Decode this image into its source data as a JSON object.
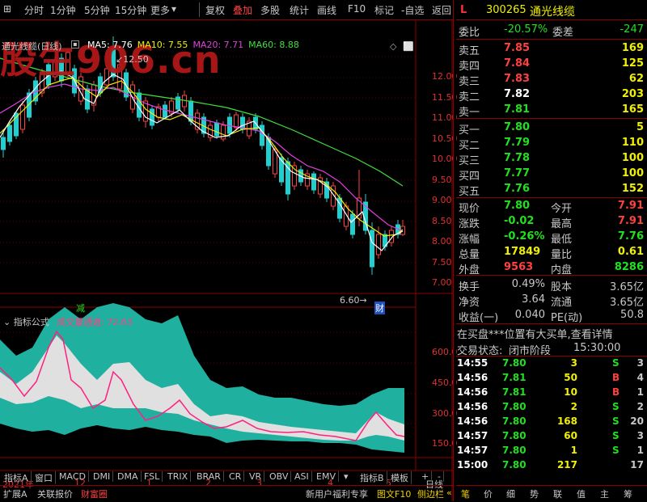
{
  "toolbar": {
    "left": [
      "分时",
      "1分钟",
      "5分钟",
      "15分钟",
      "更多"
    ],
    "right": [
      "复权",
      "叠加",
      "多股",
      "统计",
      "画线",
      "F10",
      "标记",
      "-自选",
      "返回"
    ]
  },
  "watermark": "股生906.cn",
  "main_chart": {
    "title": "通光线缆(日线)",
    "ma": [
      {
        "label": "MA5: 7.76",
        "color": "#ffffff"
      },
      {
        "label": "MA10: 7.55",
        "color": "#f0f000"
      },
      {
        "label": "MA20: 7.71",
        "color": "#e040e0"
      },
      {
        "label": "MA60: 8.88",
        "color": "#40e040"
      }
    ],
    "high_label": "12.50",
    "low_label": "6.60",
    "mark_jian": "减",
    "mark_cai": "财",
    "y_ticks": [
      "12.00",
      "11.50",
      "11.00",
      "10.50",
      "10.00",
      "9.50",
      "9.00",
      "8.50",
      "8.00",
      "7.50",
      "7.00"
    ]
  },
  "indicator": {
    "title": "指标公式",
    "name": "成交量通道",
    "value": "72.63",
    "y_ticks": [
      "600.0",
      "450.0",
      "300.0",
      "150.0"
    ]
  },
  "x_axis": {
    "labels": [
      "2021年",
      "12",
      "1",
      "2",
      "3",
      "4",
      "5"
    ],
    "period": "日线"
  },
  "indicator_tabs": [
    "指标A",
    "窗口",
    "MACD",
    "DMI",
    "DMA",
    "FSL",
    "TRIX",
    "BRAR",
    "CR",
    "VR",
    "OBV",
    "ASI",
    "EMV"
  ],
  "indicator_tabs_right": [
    "指标B",
    "模板",
    "+",
    "-"
  ],
  "bottom_left": [
    "扩展A",
    "关联报价",
    "财富圈"
  ],
  "bottom_mid": [
    "新用户福利专享",
    "图文F10",
    "侧边栏"
  ],
  "bottom_right": [
    "笔",
    "价",
    "细",
    "势",
    "联",
    "值",
    "主",
    "筹"
  ],
  "quote": {
    "flag": "L",
    "code": "300265",
    "name": "通光线缆",
    "weibi_label": "委比",
    "weibi": "-20.57%",
    "weicha_label": "委差",
    "weicha": "-247",
    "sell": [
      {
        "label": "卖五",
        "price": "7.85",
        "vol": "169"
      },
      {
        "label": "卖四",
        "price": "7.84",
        "vol": "125"
      },
      {
        "label": "卖三",
        "price": "7.83",
        "vol": "62"
      },
      {
        "label": "卖二",
        "price": "7.82",
        "vol": "203"
      },
      {
        "label": "卖一",
        "price": "7.81",
        "vol": "165"
      }
    ],
    "buy": [
      {
        "label": "买一",
        "price": "7.80",
        "vol": "5"
      },
      {
        "label": "买二",
        "price": "7.79",
        "vol": "110"
      },
      {
        "label": "买三",
        "price": "7.78",
        "vol": "100"
      },
      {
        "label": "买四",
        "price": "7.77",
        "vol": "100"
      },
      {
        "label": "买五",
        "price": "7.76",
        "vol": "152"
      }
    ],
    "stats": [
      {
        "l1": "现价",
        "v1": "7.80",
        "l2": "今开",
        "v2": "7.91"
      },
      {
        "l1": "涨跌",
        "v1": "-0.02",
        "l2": "最高",
        "v2": "7.91"
      },
      {
        "l1": "涨幅",
        "v1": "-0.26%",
        "l2": "最低",
        "v2": "7.76"
      },
      {
        "l1": "总量",
        "v1": "17849",
        "l2": "量比",
        "v2": "0.61"
      },
      {
        "l1": "外盘",
        "v1": "9563",
        "l2": "内盘",
        "v2": "8286"
      }
    ],
    "stats2": [
      {
        "l1": "换手",
        "v1": "0.49%",
        "l2": "股本",
        "v2": "3.65亿"
      },
      {
        "l1": "净资",
        "v1": "3.64",
        "l2": "流通",
        "v2": "3.65亿"
      },
      {
        "l1": "收益(一)",
        "v1": "0.040",
        "l2": "PE(动)",
        "v2": "50.8"
      }
    ],
    "notice": "在买盘***位置有大买单,查看详情",
    "status_label": "交易状态:",
    "status_value": "闭市阶段",
    "status_time": "15:30:00",
    "ticks": [
      {
        "t": "14:55",
        "p": "7.80",
        "v": "3",
        "d": "S",
        "n": "3"
      },
      {
        "t": "14:56",
        "p": "7.81",
        "v": "50",
        "d": "B",
        "n": "4"
      },
      {
        "t": "14:56",
        "p": "7.81",
        "v": "10",
        "d": "B",
        "n": "1"
      },
      {
        "t": "14:56",
        "p": "7.80",
        "v": "2",
        "d": "S",
        "n": "2"
      },
      {
        "t": "14:56",
        "p": "7.80",
        "v": "168",
        "d": "S",
        "n": "20"
      },
      {
        "t": "14:57",
        "p": "7.80",
        "v": "60",
        "d": "S",
        "n": "3"
      },
      {
        "t": "14:57",
        "p": "7.80",
        "v": "1",
        "d": "S",
        "n": "1"
      },
      {
        "t": "15:00",
        "p": "7.80",
        "v": "217",
        "d": "",
        "n": "17"
      }
    ]
  }
}
